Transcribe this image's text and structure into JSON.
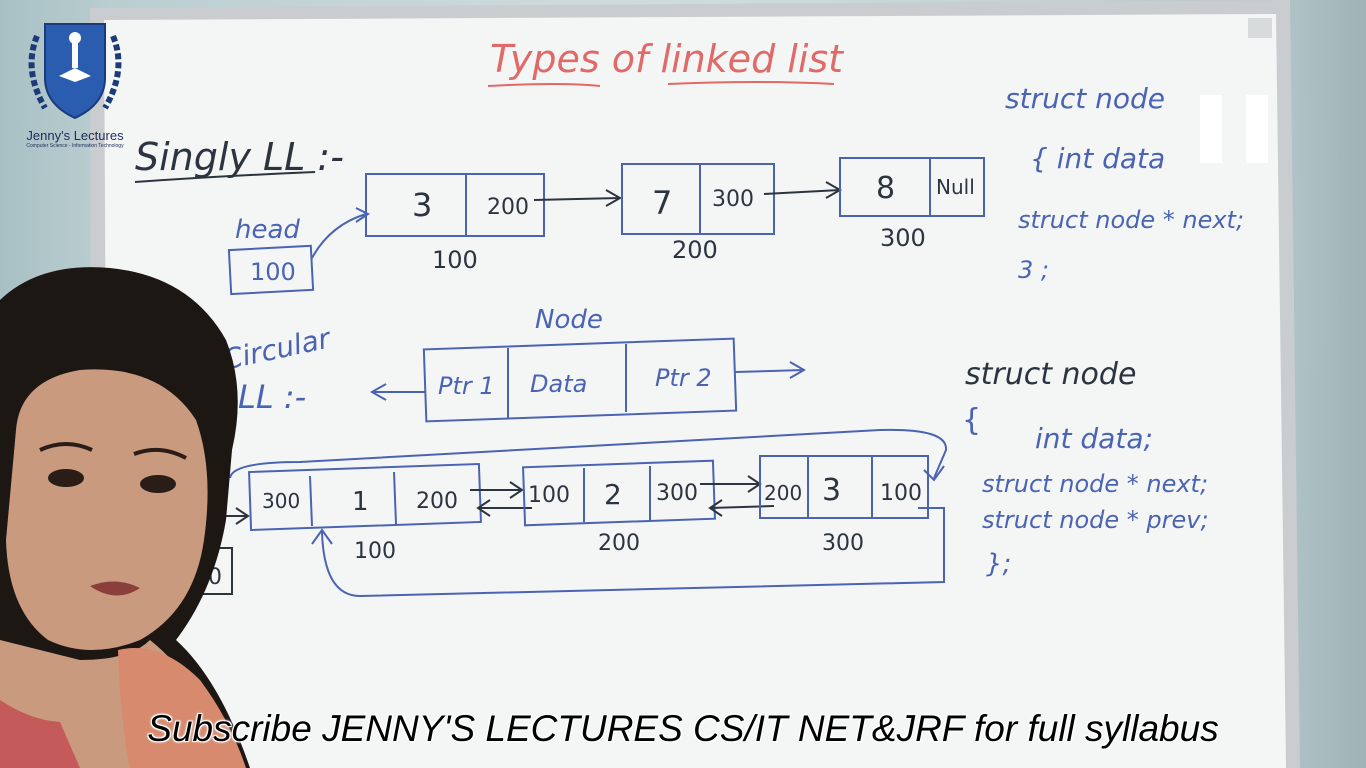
{
  "video": {
    "channel_logo_name": "Jenny's Lectures",
    "channel_logo_tagline": "Computer Science - Information Technology",
    "subtitle": "Subscribe JENNY'S LECTURES CS/IT NET&JRF for full syllabus",
    "player_state_icon": "pause-icon"
  },
  "whiteboard": {
    "title": "Types of linked list",
    "singly": {
      "heading": "Singly LL :-",
      "head_label": "head",
      "head_value": "100",
      "nodes": [
        {
          "data": "3",
          "next": "200",
          "address": "100"
        },
        {
          "data": "7",
          "next": "300",
          "address": "200"
        },
        {
          "data": "8",
          "next": "Null",
          "address": "300"
        }
      ],
      "struct_code": [
        "struct node",
        "{   int data",
        "struct node * next;",
        "3 ;"
      ]
    },
    "node_diagram": {
      "label": "Node",
      "fields": [
        "Ptr 1",
        "Data",
        "Ptr 2"
      ]
    },
    "circular": {
      "heading_line1": "Circular",
      "heading_line2": "LL :-",
      "partial_head_value": "00",
      "nodes": [
        {
          "prev": "300",
          "data": "1",
          "next": "200",
          "address": "100"
        },
        {
          "prev": "100",
          "data": "2",
          "next": "300",
          "address": "200"
        },
        {
          "prev": "200",
          "data": "3",
          "next": "100",
          "address": "300"
        }
      ],
      "struct_code": [
        "struct node",
        "{",
        "int data;",
        "struct node * next;",
        "struct node * prev;",
        "};"
      ]
    }
  },
  "colors": {
    "marker_black": "#2c3440",
    "marker_blue": "#4a63b3",
    "marker_red": "#e06a68",
    "board_white": "#f4f6f6",
    "frame_gray": "#c9cdcf"
  }
}
